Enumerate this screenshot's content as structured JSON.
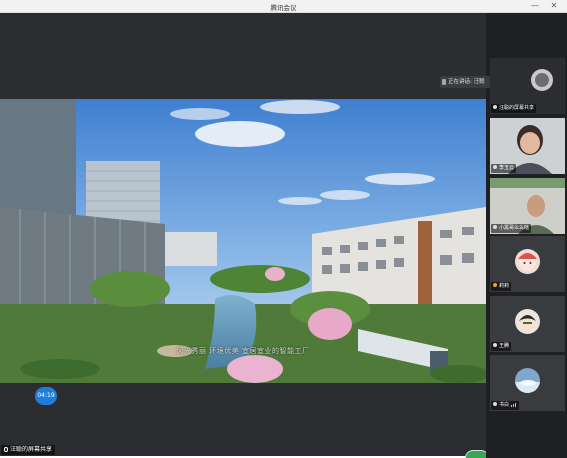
{
  "window": {
    "title": "腾讯会议",
    "minimize_glyph": "—",
    "close_glyph": "✕"
  },
  "stage": {
    "caption": "风光秀丽 环境优美 宜居宜业的智能工厂",
    "timer": "04:19",
    "share_label": "汪聪的屏幕共享"
  },
  "speaking": {
    "text": "正在讲话: 汪聪"
  },
  "participants": [
    {
      "label": "汪聪的屏幕共享",
      "icon": "avatar-icon"
    },
    {
      "label": "李玉云",
      "icon": "avatar-icon"
    },
    {
      "label": "小黑哥么么哒",
      "icon": "avatar-icon"
    },
    {
      "label": "莉莉",
      "icon": "cartoon-avatar-icon"
    },
    {
      "label": "王腾",
      "icon": "cartoon-avatar-icon"
    },
    {
      "label": "书白",
      "icon": "avatar-icon"
    }
  ],
  "colors": {
    "accent": "#1f7fd8",
    "status_green": "#3aa757",
    "stage_bg": "#2b2d31"
  }
}
